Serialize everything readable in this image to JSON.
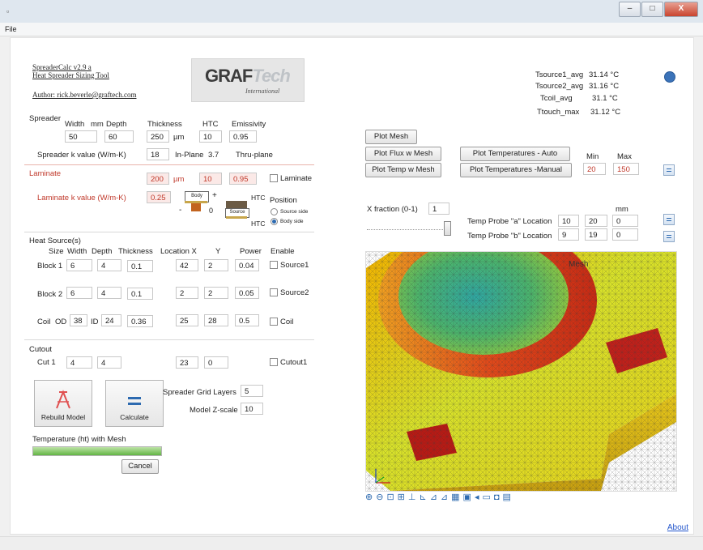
{
  "window": {
    "icon": "app-icon",
    "controls": [
      "–",
      "□",
      "X"
    ]
  },
  "menu": {
    "file": "File"
  },
  "header": {
    "version": "SpreaderCalc v2.9 a",
    "tool": "Heat Spreader Sizing Tool",
    "author": "Author: rick.beverle@graftech.com",
    "logo_main": "GRAF",
    "logo_accent": "Tech",
    "logo_sub": "International"
  },
  "results": {
    "rows": [
      {
        "label": "Tsource1_avg",
        "value": "31.14 °C"
      },
      {
        "label": "Tsource2_avg",
        "value": "31.16 °C"
      },
      {
        "label": "Tcoil_avg",
        "value": "31.1 °C"
      },
      {
        "label": "Ttouch_max",
        "value": "31.12 °C"
      }
    ]
  },
  "spreader": {
    "title": "Spreader",
    "h_width": "Width",
    "h_mm": "mm",
    "h_depth": "Depth",
    "h_thickness": "Thickness",
    "h_htc": "HTC",
    "h_emissivity": "Emissivity",
    "width": "50",
    "depth": "60",
    "thickness": "250",
    "um": "µm",
    "htc": "10",
    "emissivity": "0.95",
    "k_label": "Spreader k value (W/m-K)",
    "k_inplane": "18",
    "inplane_label": "In-Plane",
    "k_thru": "3.7",
    "thru_label": "Thru-plane"
  },
  "laminate": {
    "title": "Laminate",
    "thickness": "200",
    "um": "µm",
    "htc": "10",
    "emissivity": "0.95",
    "enable_label": "Laminate",
    "k_label": "Laminate k value (W/m-K)",
    "k": "0.25",
    "htc_top": "HTC",
    "htc_bottom": "HTC",
    "position_label": "Position",
    "opt_source": "Source side",
    "opt_body": "Body side",
    "diag_body": "Body",
    "diag_source": "Source",
    "plus": "+",
    "minus": "-",
    "zero": "0"
  },
  "heat": {
    "title": "Heat Source(s)",
    "h_size": "Size",
    "h_width": "Width",
    "h_depth": "Depth",
    "h_thickness": "Thickness",
    "h_locx": "Location X",
    "h_y": "Y",
    "h_power": "Power",
    "h_enable": "Enable",
    "block1": {
      "label": "Block 1",
      "w": "6",
      "d": "4",
      "t": "0.1",
      "x": "42",
      "y": "2",
      "p": "0.04",
      "en": "Source1"
    },
    "block2": {
      "label": "Block 2",
      "w": "6",
      "d": "4",
      "t": "0.1",
      "x": "2",
      "y": "2",
      "p": "0.05",
      "en": "Source2"
    },
    "coil": {
      "label": "Coil",
      "od_label": "OD",
      "od": "38",
      "id_label": "ID",
      "id": "24",
      "t": "0.36",
      "x": "25",
      "y": "28",
      "p": "0.5",
      "en": "Coil"
    }
  },
  "cutout": {
    "title": "Cutout",
    "label": "Cut 1",
    "w": "4",
    "d": "4",
    "x": "23",
    "y": "0",
    "en": "Cutout1"
  },
  "actions": {
    "rebuild": "Rebuild Model",
    "calculate": "Calculate",
    "grid_label": "Spreader Grid Layers",
    "grid": "5",
    "zscale_label": "Model Z-scale",
    "zscale": "10",
    "progress_label": "Temperature (ht) with Mesh",
    "progress": 1.0,
    "cancel": "Cancel"
  },
  "plots": {
    "plot_mesh": "Plot Mesh",
    "plot_flux": "Plot Flux w Mesh",
    "plot_temp": "Plot Temp w Mesh",
    "auto": "Plot Temperatures - Auto",
    "manual": "Plot Temperatures -Manual",
    "min_label": "Min",
    "max_label": "Max",
    "min": "20",
    "max": "150"
  },
  "probes": {
    "xfrac_label": "X fraction (0-1)",
    "xfrac": "1",
    "mm": "mm",
    "a_label": "Temp Probe \"a\" Location",
    "a": [
      "10",
      "20",
      "0"
    ],
    "b_label": "Temp Probe \"b\" Location",
    "b": [
      "9",
      "19",
      "0"
    ]
  },
  "view": {
    "title": "Mesh",
    "icons": [
      "zoom-in-icon",
      "zoom-out-icon",
      "zoom-box-icon",
      "zoom-extents-icon",
      "axis-icon",
      "view-xy-icon",
      "view-yz-icon",
      "view-zx-icon",
      "grid-icon",
      "render-icon",
      "prev-icon",
      "next-icon",
      "camera-icon",
      "print-icon"
    ]
  },
  "about": "About"
}
